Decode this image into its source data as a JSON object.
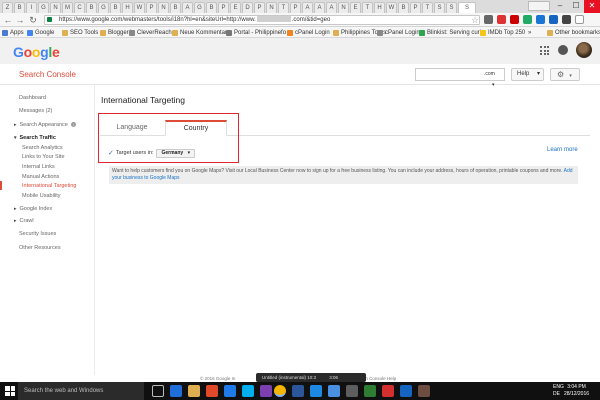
{
  "browser": {
    "url": "https://www.google.com/webmasters/tools/i18n?hl=en&siteUrl=http://www.",
    "url_tail": ".com/&tid=geo",
    "tab_letters": [
      "Z",
      "B",
      "I",
      "G",
      "N",
      "M",
      "C",
      "B",
      "G",
      "B",
      "H",
      "W",
      "P",
      "N",
      "B",
      "A",
      "G",
      "B",
      "P",
      "E",
      "D",
      "P",
      "N",
      "T",
      "P",
      "A",
      "A",
      "A",
      "N",
      "E",
      "T",
      "H",
      "W",
      "B",
      "P",
      "T",
      "S",
      "S"
    ],
    "active_tab": "S",
    "owner_chip": "",
    "window_controls": {
      "minimize": "–",
      "maximize": "☐",
      "close": "✕"
    }
  },
  "bookmarks": {
    "items": [
      "Apps",
      "Google",
      "SEO Tools",
      "Bloggeré",
      "CleverReach",
      "Neue Kommentare",
      "Portal - Philippinefo",
      "cPanel Login",
      "Philippines Tours",
      "cPanel Login",
      "Blinkist: Serving curi",
      "IMDb Top 250"
    ],
    "overflow": "»",
    "other": "Other bookmarks"
  },
  "google": {
    "logo_letters": [
      {
        "char": "G",
        "color": "#4285f4"
      },
      {
        "char": "o",
        "color": "#ea4335"
      },
      {
        "char": "o",
        "color": "#fbbc05"
      },
      {
        "char": "g",
        "color": "#4285f4"
      },
      {
        "char": "l",
        "color": "#34a853"
      },
      {
        "char": "e",
        "color": "#ea4335"
      }
    ]
  },
  "console": {
    "title": "Search Console",
    "property_suffix": ".com",
    "help_label": "Help",
    "gear_caret": "▾",
    "help_caret": "▾"
  },
  "sidebar": {
    "dashboard": "Dashboard",
    "messages": "Messages (2)",
    "search_appearance": "Search Appearance",
    "search_traffic": "Search Traffic",
    "search_analytics": "Search Analytics",
    "links_to_site": "Links to Your Site",
    "internal_links": "Internal Links",
    "manual_actions": "Manual Actions",
    "international_targeting": "International Targeting",
    "mobile_usability": "Mobile Usability",
    "google_index": "Google Index",
    "crawl": "Crawl",
    "security_issues": "Security Issues",
    "other_resources": "Other Resources"
  },
  "main": {
    "title": "International Targeting",
    "tabs": {
      "language": "Language",
      "country": "Country"
    },
    "target_label": "Target users in:",
    "country_value": "Germany",
    "learn_more": "Learn more",
    "info_text": "Want to help customers find you on Google Maps? Visit our Local Business Center now to sign up for a free business listing. You can include your address, hours of operation, printable coupons and more.",
    "info_link": "Add your business to Google Maps"
  },
  "footer": {
    "left": "© 2016 Google In",
    "right": "earch Console Help",
    "media_title": "Untitled (instrumental) 10:3",
    "media_time": "3:06"
  },
  "taskbar": {
    "search_placeholder": "Search the web and Windows",
    "lang_top": "ENG",
    "lang_bottom": "DE",
    "time": "3:04 PM",
    "date": "28/12/2016"
  }
}
